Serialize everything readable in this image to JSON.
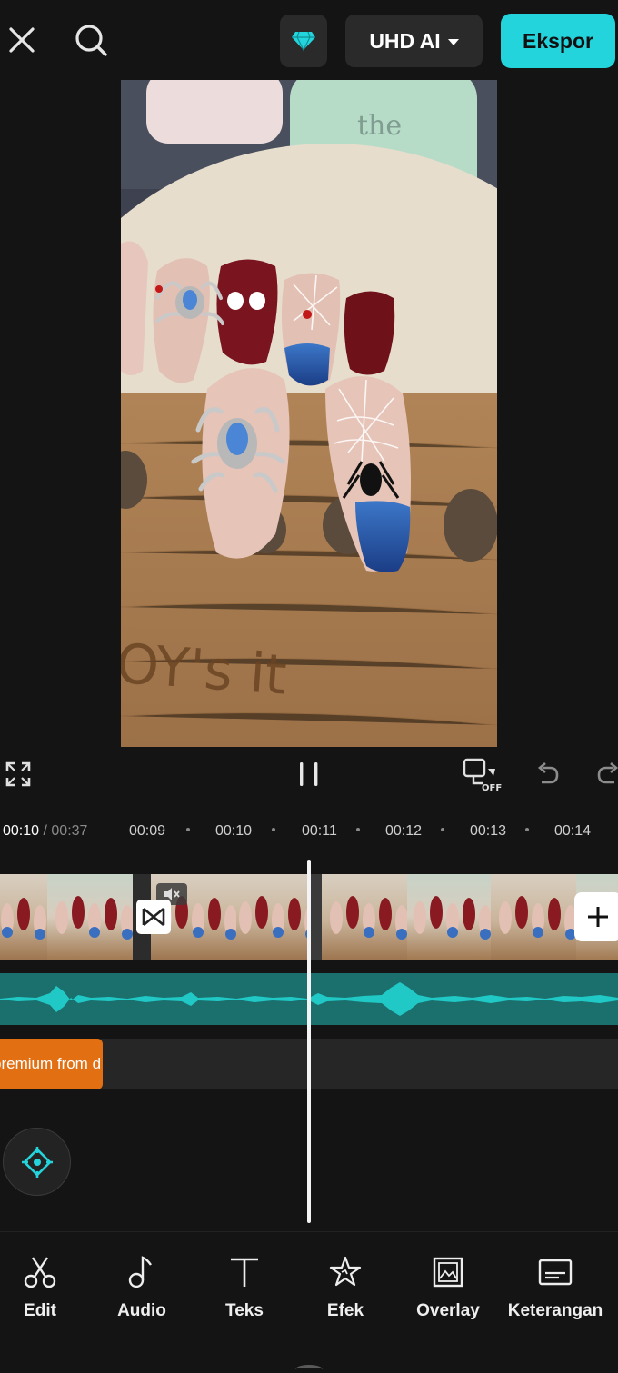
{
  "topbar": {
    "close_icon": "close-icon",
    "search_icon": "search-icon",
    "pro_icon": "diamond-icon",
    "resolution_label": "UHD AI",
    "export_label": "Ekspor",
    "accent_color": "#24d4dc"
  },
  "preview": {
    "board_text": "OY's it"
  },
  "controls": {
    "fullscreen_icon": "fullscreen-icon",
    "pause_icon": "pause-icon",
    "keyframe_off_icon": "keyframe-off-icon",
    "keyframe_off_label": "OFF",
    "undo_icon": "undo-icon",
    "redo_icon": "redo-icon"
  },
  "timeline": {
    "current_time": "00:10",
    "separator": " / ",
    "total_time": "00:37",
    "ticks": [
      "00:09",
      "00:10",
      "00:11",
      "00:12",
      "00:13",
      "00:14"
    ],
    "text_clip": "premium from d",
    "audio_color": "#21c9c6",
    "text_clip_color": "#e26f12"
  },
  "toolbar": {
    "items": [
      {
        "label": "Edit",
        "icon": "scissors-icon"
      },
      {
        "label": "Audio",
        "icon": "music-note-icon"
      },
      {
        "label": "Teks",
        "icon": "text-icon"
      },
      {
        "label": "Efek",
        "icon": "star-effect-icon"
      },
      {
        "label": "Overlay",
        "icon": "overlay-icon"
      },
      {
        "label": "Keterangan",
        "icon": "captions-icon"
      }
    ]
  }
}
